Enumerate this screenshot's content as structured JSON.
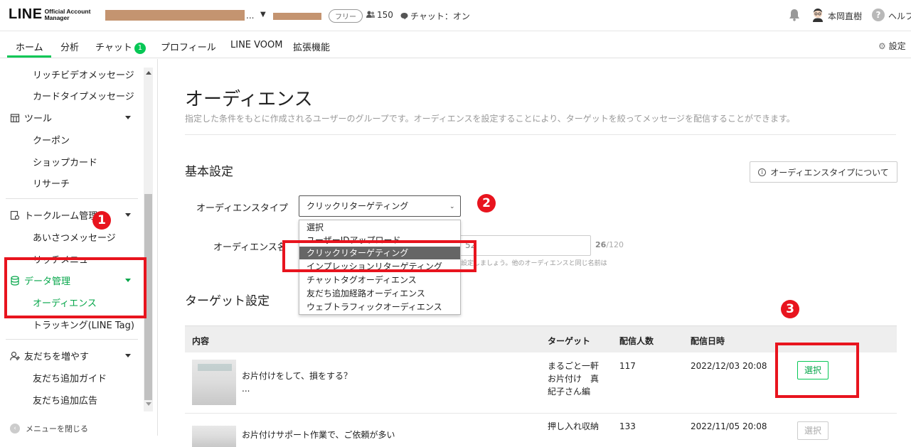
{
  "header": {
    "logo_main": "LINE",
    "logo_sub_1": "Official Account",
    "logo_sub_2": "Manager",
    "account_name_suffix": "...",
    "plan_badge": "フリー",
    "friend_count": "150",
    "chat_status": "チャット：オン",
    "user_name": "本岡直樹",
    "help_label": "ヘルプ"
  },
  "tabs": [
    {
      "label": "ホーム",
      "active": true
    },
    {
      "label": "分析"
    },
    {
      "label": "チャット",
      "badge": "1"
    },
    {
      "label": "プロフィール"
    },
    {
      "label": "LINE VOOM"
    },
    {
      "label": "拡張機能"
    }
  ],
  "settings_label": "設定",
  "sidebar": {
    "items_top": [
      "リッチビデオメッセージ",
      "カードタイプメッセージ"
    ],
    "tools": {
      "label": "ツール",
      "items": [
        "クーポン",
        "ショップカード",
        "リサーチ"
      ]
    },
    "talkroom": {
      "label": "トークルーム管理",
      "items": [
        "あいさつメッセージ",
        "リッチメニュー"
      ]
    },
    "data": {
      "label": "データ管理",
      "items": [
        "オーディエンス",
        "トラッキング(LINE Tag)"
      ]
    },
    "friends": {
      "label": "友だちを増やす",
      "items": [
        "友だち追加ガイド",
        "友だち追加広告"
      ]
    },
    "close_menu": "メニューを閉じる"
  },
  "page": {
    "title": "オーディエンス",
    "description": "指定した条件をもとに作成されるユーザーのグループです。オーディエンスを設定することにより、ターゲットを絞ってメッセージを配信することができます。",
    "basic_settings": "基本設定",
    "about_button": "オーディエンスタイプについて",
    "audience_type_label": "オーディエンスタイプ",
    "audience_type_value": "クリックリターゲティング",
    "audience_name_label": "オーディエンス名",
    "audience_name_value_visible": "52",
    "char_count": "26",
    "char_max": "/120",
    "hint": "設定しましょう。他のオーディエンスと同じ名前は",
    "target_settings": "ターゲット設定"
  },
  "dropdown_options": [
    {
      "label": "選択"
    },
    {
      "label": "ユーザーIDアップロード"
    },
    {
      "label": "クリックリターゲティング",
      "selected": true
    },
    {
      "label": "インプレッションリターゲティング"
    },
    {
      "label": "チャットタグオーディエンス"
    },
    {
      "label": "友だち追加経路オーディエンス"
    },
    {
      "label": "ウェブトラフィックオーディエンス"
    }
  ],
  "table": {
    "headers": [
      "内容",
      "ターゲット",
      "配信人数",
      "配信日時"
    ],
    "rows": [
      {
        "content": "お片付けをして、損をする？",
        "content_more": "...",
        "target_1": "まるごと一軒",
        "target_2": "お片付け　真",
        "target_3": "紀子さん編",
        "count": "117",
        "date": "2022/12/03 20:08",
        "button": "選択"
      },
      {
        "content": "お片付けサポート作業で、ご依頼が多い",
        "target_1": "押し入れ収納",
        "count": "133",
        "date": "2022/11/05 20:08",
        "button": "選択"
      }
    ]
  },
  "annotations": [
    "1",
    "2",
    "3"
  ],
  "colors": {
    "accent_green": "#06c755",
    "annotation_red": "#e8141e",
    "redaction": "#c49470"
  }
}
